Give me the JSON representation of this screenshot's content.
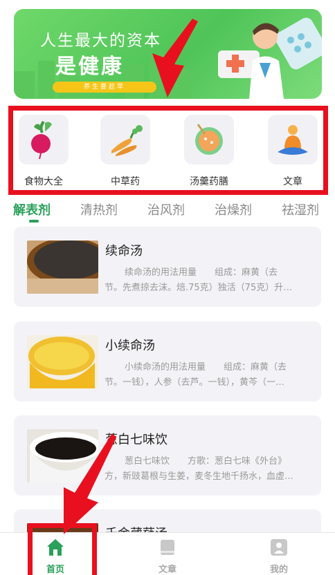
{
  "banner": {
    "headline_line1": "人生最大的资本",
    "headline_line2": "是健康",
    "tagline": "养生要趁早"
  },
  "categories": [
    {
      "label": "食物大全",
      "icon": "radish-icon"
    },
    {
      "label": "中草药",
      "icon": "herb-roots-icon"
    },
    {
      "label": "汤羹药膳",
      "icon": "soup-bowl-icon"
    },
    {
      "label": "文章",
      "icon": "meditation-icon"
    }
  ],
  "tabs": [
    "解表剂",
    "清热剂",
    "治风剂",
    "治燥剂",
    "祛湿剂"
  ],
  "active_tab": "解表剂",
  "items": [
    {
      "title": "续命汤",
      "desc_line1": "续命汤的用法用量　　组成：麻黄（去",
      "desc_line2": "节。先煮掠去沫。焙.75克）独活（75克）升…"
    },
    {
      "title": "小续命汤",
      "desc_line1": "小续命汤的用法用量　　组成：麻黄（去",
      "desc_line2": "节。一钱），人参（去芦。一钱），黄芩（一…"
    },
    {
      "title": "葱白七味饮",
      "desc_line1": "葱白七味饮　　方歌：葱白七味《外台》",
      "desc_line2": "方，新豉葛根与生姜，麦冬生地千扬水，血虚…"
    },
    {
      "title": "千金葳蕤汤",
      "desc_line1": "",
      "desc_line2": ""
    }
  ],
  "nav": [
    {
      "label": "首页",
      "icon": "home-icon",
      "active": true
    },
    {
      "label": "文章",
      "icon": "book-icon",
      "active": false
    },
    {
      "label": "我的",
      "icon": "user-icon",
      "active": false
    }
  ],
  "colors": {
    "accent": "#2aa05a",
    "annotation_red": "#e8101e",
    "banner_green": "#5fcf5f"
  }
}
